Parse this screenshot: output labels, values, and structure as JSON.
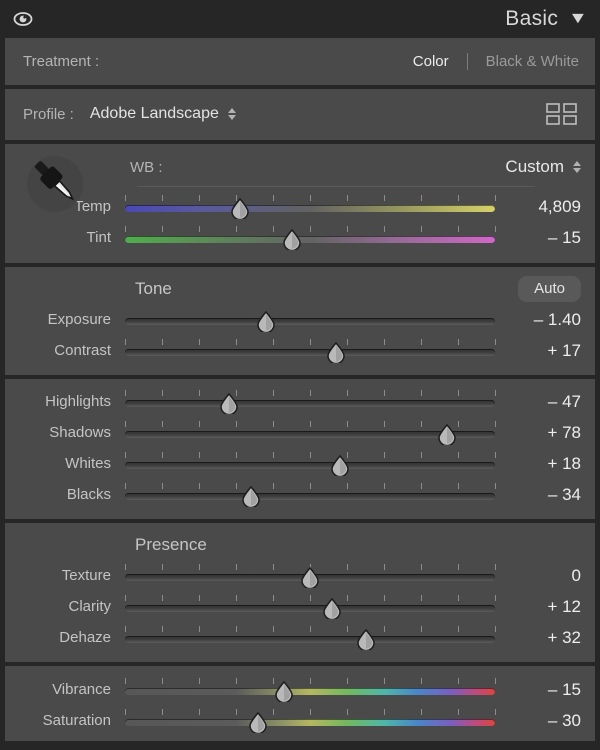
{
  "header": {
    "eye_icon": "eye-icon",
    "title": "Basic",
    "disclosure_icon": "chevron-down-icon"
  },
  "treatment": {
    "label": "Treatment :",
    "options": [
      {
        "label": "Color",
        "selected": true
      },
      {
        "label": "Black & White",
        "selected": false
      }
    ]
  },
  "profile": {
    "label": "Profile :",
    "value": "Adobe Landscape",
    "spinner_icon": "spinner-up-down-icon",
    "browser_icon": "profile-grid-icon"
  },
  "white_balance": {
    "dropper_icon": "eyedropper-icon",
    "label": "WB :",
    "value": "Custom",
    "spinner_icon": "spinner-up-down-icon",
    "sliders": [
      {
        "name": "Temp",
        "value": "4,809",
        "pos": 31,
        "track": "temp",
        "ticks": true
      },
      {
        "name": "Tint",
        "value": "– 15",
        "pos": 45,
        "track": "tint",
        "ticks": true
      }
    ]
  },
  "tone": {
    "title": "Tone",
    "auto_label": "Auto",
    "sliders": [
      {
        "name": "Exposure",
        "value": "– 1.40",
        "pos": 38,
        "track": "plain",
        "ticks": false
      },
      {
        "name": "Contrast",
        "value": "+ 17",
        "pos": 57,
        "track": "plain",
        "ticks": true
      }
    ]
  },
  "tone_detail": {
    "sliders": [
      {
        "name": "Highlights",
        "value": "– 47",
        "pos": 28,
        "track": "plain",
        "ticks": true
      },
      {
        "name": "Shadows",
        "value": "+ 78",
        "pos": 87,
        "track": "plain",
        "ticks": true
      },
      {
        "name": "Whites",
        "value": "+ 18",
        "pos": 58,
        "track": "plain",
        "ticks": true
      },
      {
        "name": "Blacks",
        "value": "– 34",
        "pos": 34,
        "track": "plain",
        "ticks": true
      }
    ]
  },
  "presence": {
    "title": "Presence",
    "sliders": [
      {
        "name": "Texture",
        "value": "0",
        "pos": 50,
        "track": "plain",
        "ticks": true
      },
      {
        "name": "Clarity",
        "value": "+ 12",
        "pos": 56,
        "track": "plain",
        "ticks": true
      },
      {
        "name": "Dehaze",
        "value": "+ 32",
        "pos": 65,
        "track": "plain",
        "ticks": true
      }
    ]
  },
  "color_mix": {
    "sliders": [
      {
        "name": "Vibrance",
        "value": "– 15",
        "pos": 43,
        "track": "vib",
        "ticks": true
      },
      {
        "name": "Saturation",
        "value": "– 30",
        "pos": 36,
        "track": "vib",
        "ticks": true
      }
    ]
  },
  "colors": {
    "panel_bg": "#262626",
    "section_bg": "#4a4a4a",
    "text_primary": "#ededed",
    "text_secondary": "#b4b4b4",
    "auto_button_bg": "#595959"
  }
}
